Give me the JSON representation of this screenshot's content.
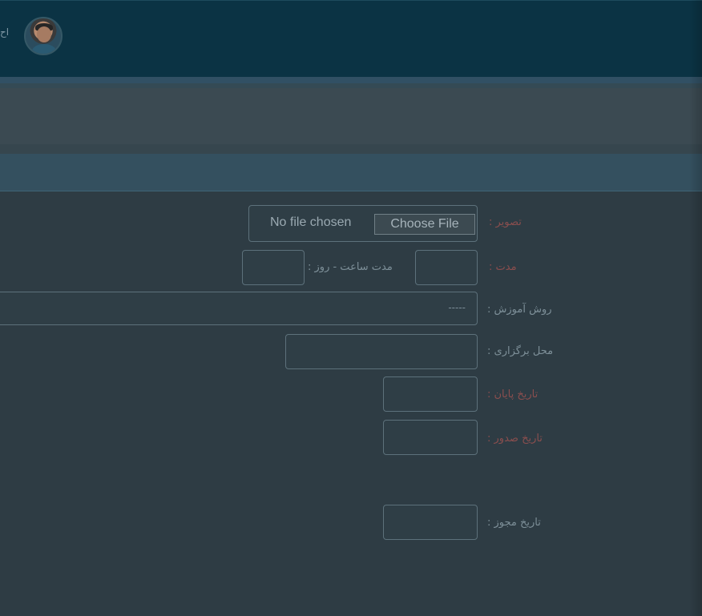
{
  "header": {
    "user_name_fragment": "اح"
  },
  "form": {
    "image": {
      "label": "تصویر :",
      "file_status": "No file chosen",
      "choose_button": "Choose File"
    },
    "duration": {
      "label": "مدت :",
      "hours_days_label": "مدت ساعت - روز :",
      "value": "",
      "hours_days_value": ""
    },
    "training_method": {
      "label": "روش آموزش :",
      "selected_value": "-----"
    },
    "venue": {
      "label": "محل برگزاری :",
      "value": ""
    },
    "end_date": {
      "label": "تاریخ پایان :",
      "value": ""
    },
    "issue_date": {
      "label": "تاریخ صدور :",
      "value": ""
    },
    "permit_date": {
      "label": "تاریخ مجوز :",
      "value": ""
    }
  },
  "colors": {
    "header_bg": "#0b3344",
    "content_bg": "#2e3c44",
    "required_label": "#8a4e4e",
    "label": "#7d8f98",
    "field_border": "#5d717b"
  }
}
